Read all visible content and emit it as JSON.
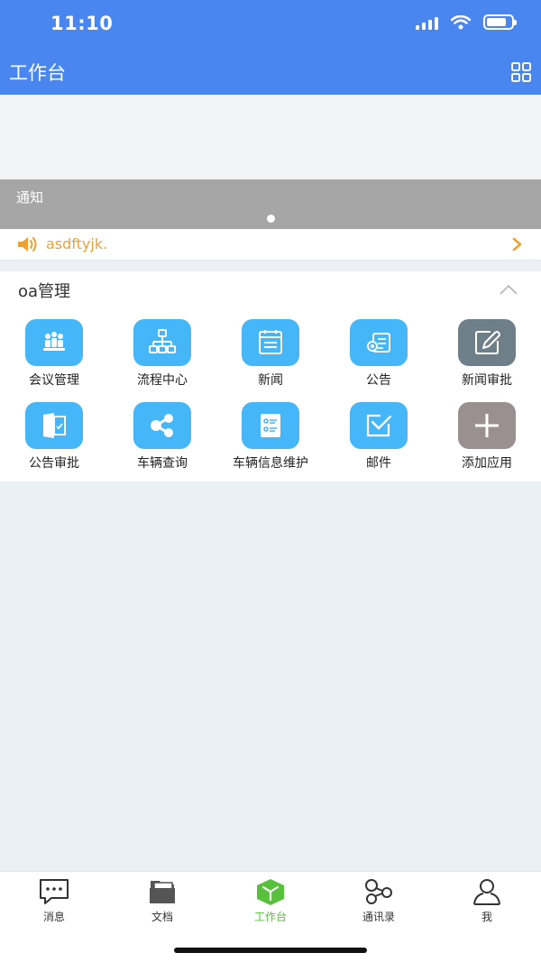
{
  "status": {
    "time": "11:10"
  },
  "header": {
    "title": "工作台"
  },
  "notice": {
    "label": "通知",
    "marquee_text": "asdftyjk."
  },
  "section": {
    "title": "oa管理"
  },
  "apps": [
    {
      "label": "会议管理",
      "icon": "meeting-icon",
      "color": "#45b6f7"
    },
    {
      "label": "流程中心",
      "icon": "flowchart-icon",
      "color": "#45b6f7"
    },
    {
      "label": "新闻",
      "icon": "news-icon",
      "color": "#45b6f7"
    },
    {
      "label": "公告",
      "icon": "announcement-icon",
      "color": "#45b6f7"
    },
    {
      "label": "新闻审批",
      "icon": "edit-icon",
      "color": "#6e7f89"
    },
    {
      "label": "公告审批",
      "icon": "approval-icon",
      "color": "#45b6f7"
    },
    {
      "label": "车辆查询",
      "icon": "share-nodes-icon",
      "color": "#45b6f7"
    },
    {
      "label": "车辆信息维护",
      "icon": "list-icon",
      "color": "#45b6f7"
    },
    {
      "label": "邮件",
      "icon": "mail-icon",
      "color": "#45b6f7"
    },
    {
      "label": "添加应用",
      "icon": "plus-icon",
      "color": "#9a9090"
    }
  ],
  "tabs": [
    {
      "label": "消息",
      "icon": "chat-icon"
    },
    {
      "label": "文档",
      "icon": "folder-icon"
    },
    {
      "label": "工作台",
      "icon": "cube-icon",
      "active": true
    },
    {
      "label": "通讯录",
      "icon": "contacts-icon"
    },
    {
      "label": "我",
      "icon": "user-icon"
    }
  ],
  "colors": {
    "primary": "#4a86f0",
    "active_tab": "#57c13b",
    "marquee_text": "#e8a23a"
  }
}
